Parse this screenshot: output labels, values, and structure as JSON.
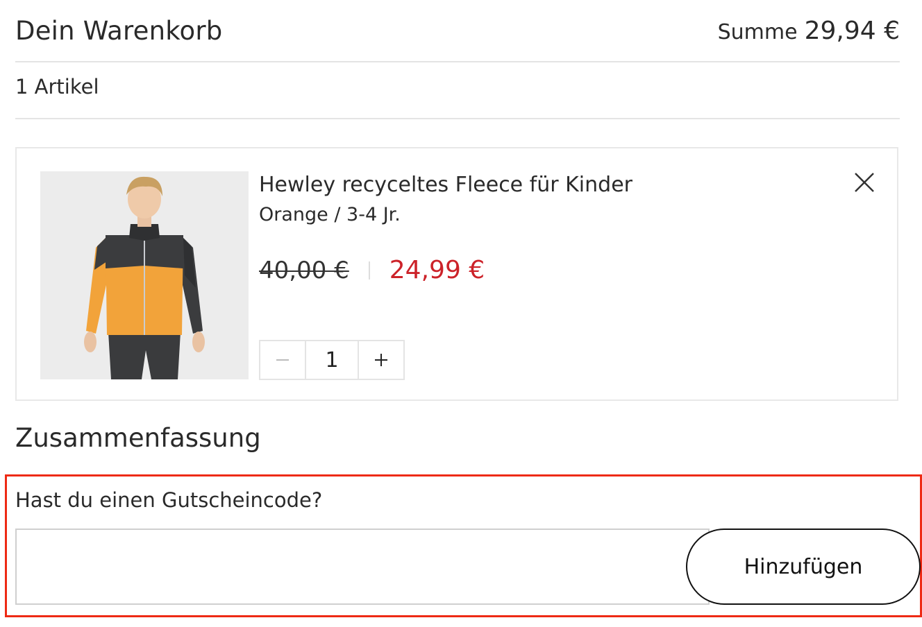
{
  "header": {
    "title": "Dein Warenkorb",
    "total_label": "Summe",
    "total_value": "29,94 €"
  },
  "cart": {
    "item_count": "1 Artikel",
    "items": [
      {
        "name": "Hewley recyceltes Fleece für Kinder",
        "variant": "Orange / 3-4 Jr.",
        "old_price": "40,00 €",
        "sale_price": "24,99 €",
        "quantity": "1",
        "image_icon": "product-photo-child-orange-fleece"
      }
    ]
  },
  "summary": {
    "heading": "Zusammenfassung"
  },
  "coupon": {
    "label": "Hast du einen Gutscheincode?",
    "input_value": "",
    "button_label": "Hinzufügen"
  },
  "icons": {
    "remove": "close-icon",
    "decrement": "minus-icon",
    "increment": "plus-icon"
  },
  "colors": {
    "sale_price": "#cc2229",
    "highlight": "#ee2a14",
    "text": "#2a2a2a"
  }
}
